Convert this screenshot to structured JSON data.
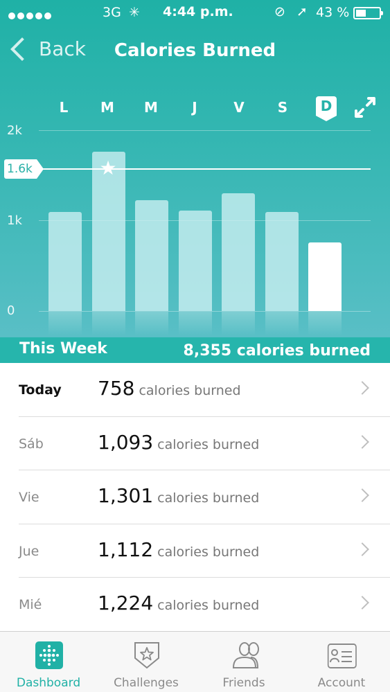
{
  "status_bar": {
    "network": "3G",
    "time": "4:44 p.m.",
    "battery": "43 %"
  },
  "nav": {
    "back_label": "Back",
    "title": "Calories Burned"
  },
  "day_tabs": [
    {
      "label": "L",
      "selected": false
    },
    {
      "label": "M",
      "selected": false
    },
    {
      "label": "M",
      "selected": false
    },
    {
      "label": "J",
      "selected": false
    },
    {
      "label": "V",
      "selected": false
    },
    {
      "label": "S",
      "selected": false
    },
    {
      "label": "D",
      "selected": true
    }
  ],
  "colors": {
    "accent": "#26b2aa",
    "bar": "#cdf0f2",
    "bar_today": "#ffffff"
  },
  "chart_data": {
    "type": "bar",
    "categories": [
      "L",
      "M",
      "M",
      "J",
      "V",
      "S",
      "D"
    ],
    "values": [
      1093,
      1760,
      1224,
      1112,
      1301,
      1093,
      758
    ],
    "goal": 1600,
    "goal_label": "1.6k",
    "ylim": [
      0,
      2000
    ],
    "yticks": [
      {
        "value": 2000,
        "label": "2k"
      },
      {
        "value": 1000,
        "label": "1k"
      },
      {
        "value": 0,
        "label": "0"
      }
    ],
    "highlight_index": 6,
    "star_index": 1
  },
  "summary": {
    "label": "This Week",
    "total": "8,355 calories burned"
  },
  "list": [
    {
      "day": "Today",
      "value": "758",
      "unit": "calories burned",
      "is_today": true
    },
    {
      "day": "Sáb",
      "value": "1,093",
      "unit": "calories burned",
      "is_today": false
    },
    {
      "day": "Vie",
      "value": "1,301",
      "unit": "calories burned",
      "is_today": false
    },
    {
      "day": "Jue",
      "value": "1,112",
      "unit": "calories burned",
      "is_today": false
    },
    {
      "day": "Mié",
      "value": "1,224",
      "unit": "calories burned",
      "is_today": false
    }
  ],
  "tabs": [
    {
      "label": "Dashboard",
      "icon": "dashboard-icon",
      "active": true
    },
    {
      "label": "Challenges",
      "icon": "challenges-icon",
      "active": false
    },
    {
      "label": "Friends",
      "icon": "friends-icon",
      "active": false
    },
    {
      "label": "Account",
      "icon": "account-icon",
      "active": false
    }
  ]
}
